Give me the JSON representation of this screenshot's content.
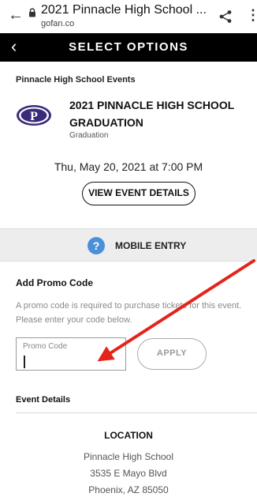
{
  "browser": {
    "page_title": "2021 Pinnacle High School ...",
    "domain": "gofan.co",
    "back_glyph": "←",
    "more_glyph": "⋮"
  },
  "header": {
    "back_glyph": "‹",
    "title": "SELECT OPTIONS"
  },
  "event": {
    "organization": "Pinnacle High School Events",
    "name": "2021 PINNACLE HIGH SCHOOL GRADUATION",
    "type": "Graduation",
    "datetime": "Thu, May 20, 2021 at 7:00 PM",
    "details_button": "VIEW EVENT DETAILS",
    "logo_letter": "P",
    "logo_color": "#3a2a7a"
  },
  "mobile_entry": {
    "icon_glyph": "?",
    "label": "MOBILE ENTRY",
    "icon_color": "#4a90d9"
  },
  "promo": {
    "heading": "Add Promo Code",
    "description": "A promo code is required to purchase tickets for this event. Please enter your code below.",
    "field_label": "Promo Code",
    "field_value": "",
    "apply_label": "APPLY"
  },
  "event_details": {
    "heading": "Event Details",
    "location_heading": "LOCATION",
    "location_lines": [
      "Pinnacle High School",
      "3535 E Mayo Blvd",
      "Phoenix, AZ 85050"
    ]
  },
  "annotation": {
    "arrow_color": "#e3241b"
  }
}
